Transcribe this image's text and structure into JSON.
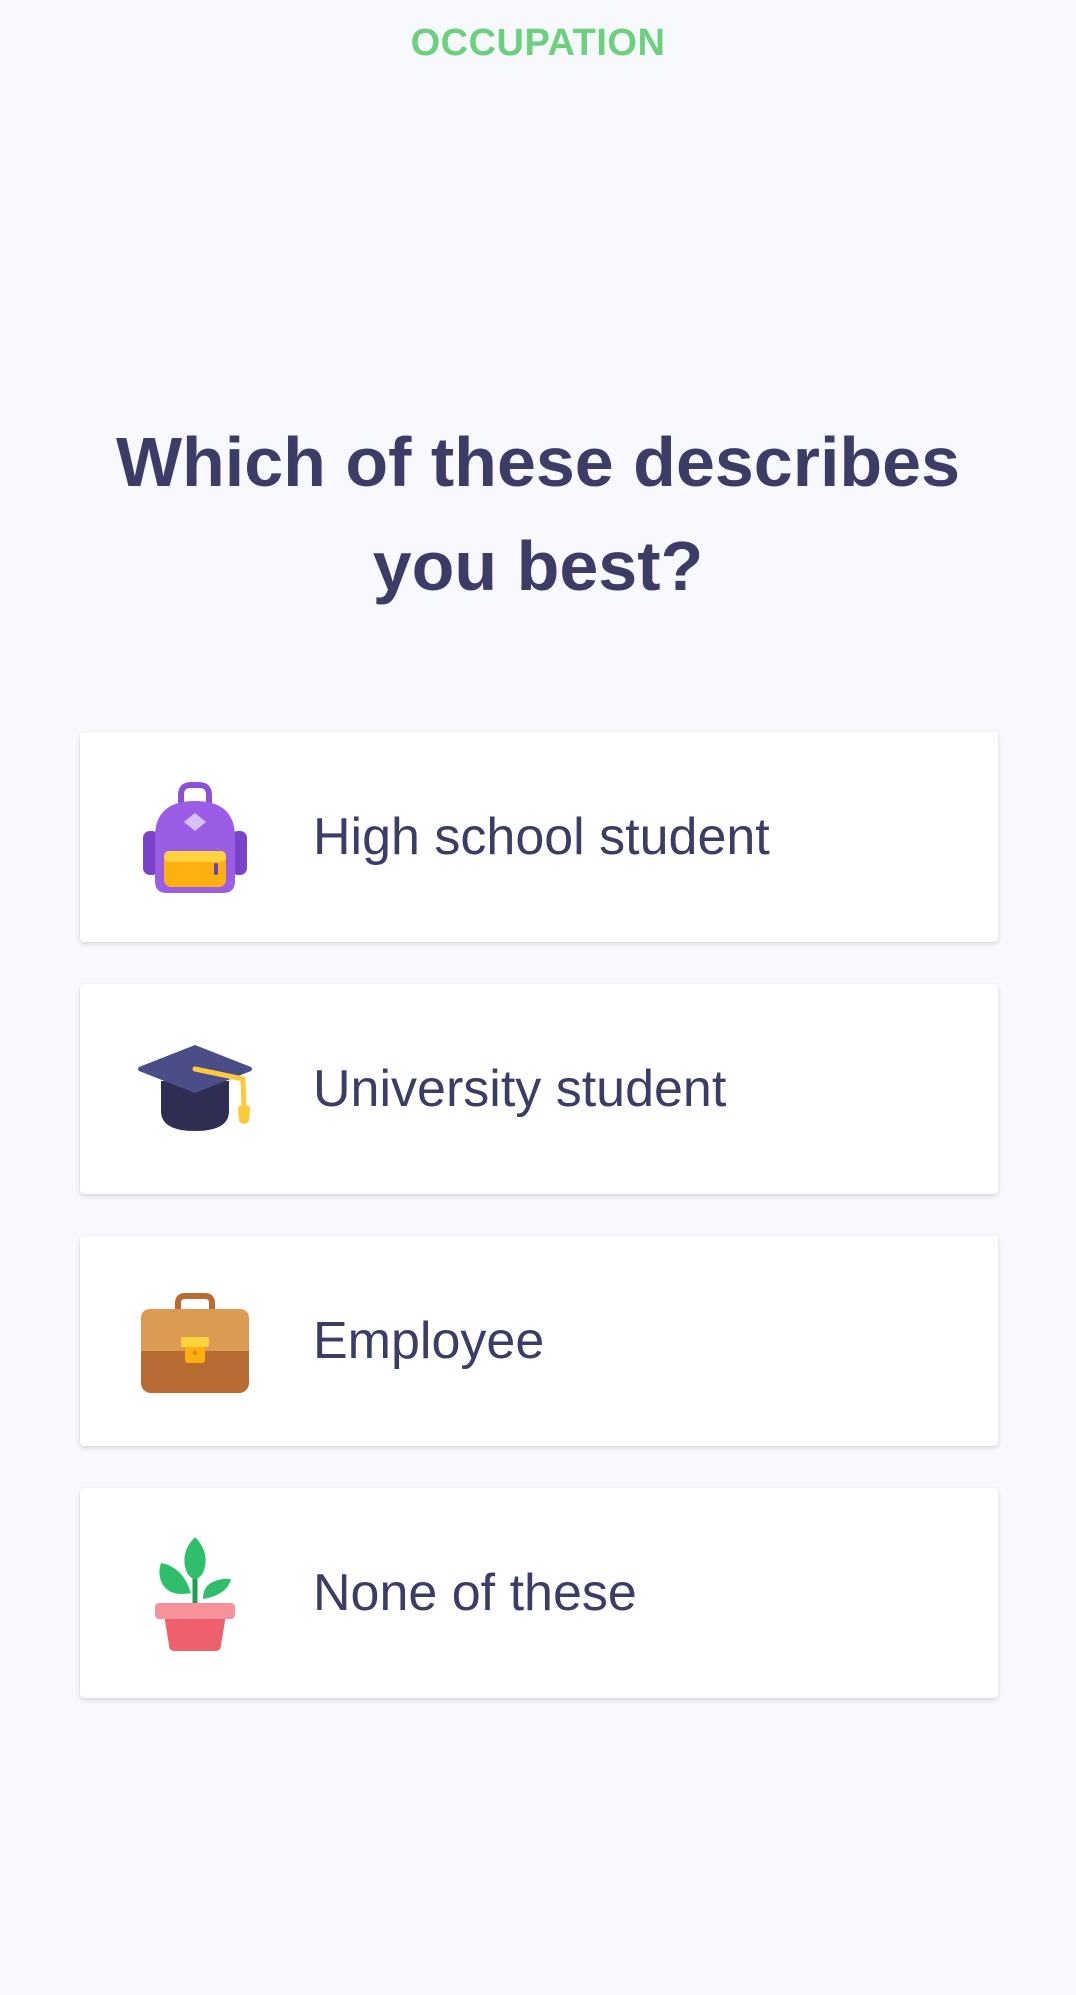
{
  "header": {
    "section_label": "OCCUPATION"
  },
  "question": {
    "line1": "Which of these describes",
    "line2": "you best?"
  },
  "options": [
    {
      "label": "High school student",
      "icon": "backpack-icon"
    },
    {
      "label": "University student",
      "icon": "graduation-cap-icon"
    },
    {
      "label": "Employee",
      "icon": "briefcase-icon"
    },
    {
      "label": "None of these",
      "icon": "potted-plant-icon"
    }
  ],
  "colors": {
    "accent": "#6cd07e",
    "text": "#3b3d66",
    "background": "#f8f9fc",
    "card": "#ffffff"
  }
}
